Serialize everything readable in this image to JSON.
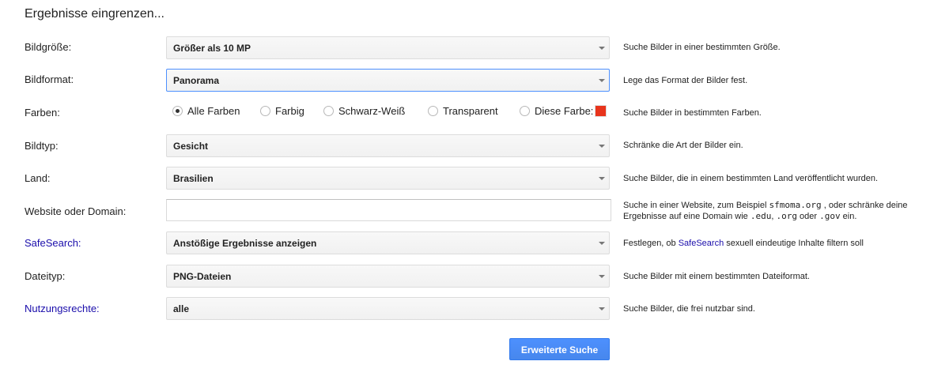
{
  "page": {
    "heading": "Ergebnisse eingrenzen..."
  },
  "fields": {
    "size": {
      "label": "Bildgröße:",
      "value": "Größer als 10 MP",
      "help": "Suche Bilder in einer bestimmten Größe."
    },
    "format": {
      "label": "Bildformat:",
      "value": "Panorama",
      "help": "Lege das Format der Bilder fest."
    },
    "colors": {
      "label": "Farben:",
      "options": [
        "Alle Farben",
        "Farbig",
        "Schwarz-Weiß",
        "Transparent",
        "Diese Farbe:"
      ],
      "selected": "Alle Farben",
      "swatch_color": "#e8341c",
      "help": "Suche Bilder in bestimmten Farben."
    },
    "type": {
      "label": "Bildtyp:",
      "value": "Gesicht",
      "help": "Schränke die Art der Bilder ein."
    },
    "country": {
      "label": "Land:",
      "value": "Brasilien",
      "help": "Suche Bilder, die in einem bestimmten Land veröffentlicht wurden."
    },
    "site": {
      "label": "Website oder Domain:",
      "value": "",
      "help_prefix": "Suche in einer Website, zum Beispiel",
      "help_example_site": "sfmoma.org",
      "help_middle": ", oder schränke deine Ergebnisse auf eine Domain wie",
      "help_domain_1": ".edu",
      "help_comma": ",",
      "help_domain_2": ".org",
      "help_oder": "oder",
      "help_domain_3": ".gov",
      "help_suffix": "ein."
    },
    "safesearch": {
      "label": "SafeSearch:",
      "value": "Anstößige Ergebnisse anzeigen",
      "help_prefix": "Festlegen, ob",
      "help_link": "SafeSearch",
      "help_suffix": "sexuell eindeutige Inhalte filtern soll"
    },
    "filetype": {
      "label": "Dateityp:",
      "value": "PNG-Dateien",
      "help": "Suche Bilder mit einem bestimmten Dateiformat."
    },
    "rights": {
      "label": "Nutzungsrechte:",
      "value": "alle",
      "help": "Suche Bilder, die frei nutzbar sind."
    }
  },
  "actions": {
    "submit_label": "Erweiterte Suche"
  },
  "colors": {
    "link": "#1a0dab",
    "button_blue": "#4d90fe",
    "focus_border": "#4d90fe"
  }
}
